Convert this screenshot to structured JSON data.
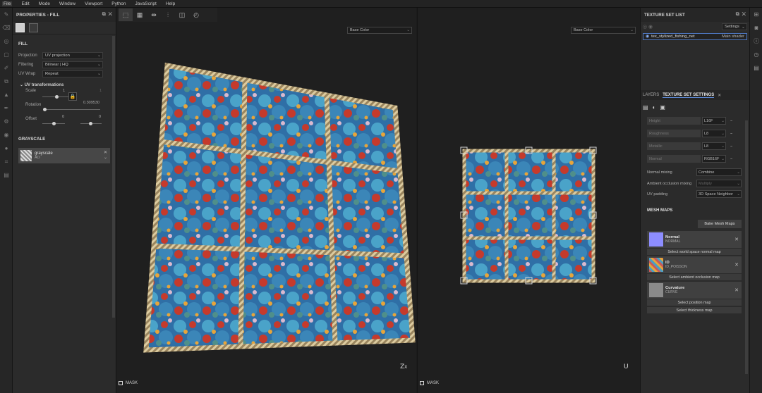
{
  "menu": [
    "File",
    "Edit",
    "Mode",
    "Window",
    "Viewport",
    "Python",
    "JavaScript",
    "Help"
  ],
  "properties": {
    "title": "PROPERTIES - FILL",
    "section": "FILL",
    "projection_label": "Projection",
    "projection_value": "UV projection",
    "filtering_label": "Filtering",
    "filtering_value": "Bilinear | HQ",
    "uvwrap_label": "UV Wrap",
    "uvwrap_value": "Repeat",
    "uv_transform_label": "UV transformations",
    "scale_label": "Scale",
    "scale_u": "1",
    "scale_v": "1",
    "rotation_label": "Rotation",
    "rotation_value": "0.309530",
    "offset_label": "Offset",
    "offset_u": "0",
    "offset_v": "0",
    "grayscale_section": "GRAYSCALE",
    "grayscale_name": "grayscale",
    "grayscale_sub": "AO"
  },
  "viewport": {
    "channel_left": "Base Color",
    "channel_right": "Base Color",
    "mask_left": "MASK",
    "mask_right": "MASK",
    "gizmo_left": "Z",
    "gizmo_left_sub": "X",
    "gizmo_right": "U"
  },
  "texture_set_list": {
    "title": "TEXTURE SET LIST",
    "settings": "Settings",
    "item_name": "tex_stylized_fishing_net",
    "item_shader": "Main shader"
  },
  "tabs": {
    "layers": "LAYERS",
    "tss": "TEXTURE SET SETTINGS"
  },
  "channels": [
    {
      "name": "Height",
      "format": "L16F"
    },
    {
      "name": "Roughness",
      "format": "L8"
    },
    {
      "name": "Metallic",
      "format": "L8"
    },
    {
      "name": "Normal",
      "format": "RGB16F"
    }
  ],
  "options": {
    "normal_mixing_label": "Normal mixing",
    "normal_mixing_value": "Combine",
    "ao_mixing_label": "Ambient occlusion mixing",
    "ao_mixing_value": "Multiply",
    "uv_padding_label": "UV padding",
    "uv_padding_value": "3D Space Neighbor"
  },
  "mesh_maps": {
    "title": "MESH MAPS",
    "bake_button": "Bake Mesh Maps",
    "maps": [
      {
        "name": "Normal",
        "sub": "NORMAL",
        "button": "Select world space normal map",
        "color": "#8d8dff"
      },
      {
        "name": "ID",
        "sub": "ID_POISSON",
        "button": "Select ambient occlusion map",
        "color": "#c85a5a"
      },
      {
        "name": "Curvature",
        "sub": "CURVE",
        "button": "Select position map",
        "color": "#8a8a8a"
      }
    ],
    "thickness_button": "Select thickness map"
  }
}
